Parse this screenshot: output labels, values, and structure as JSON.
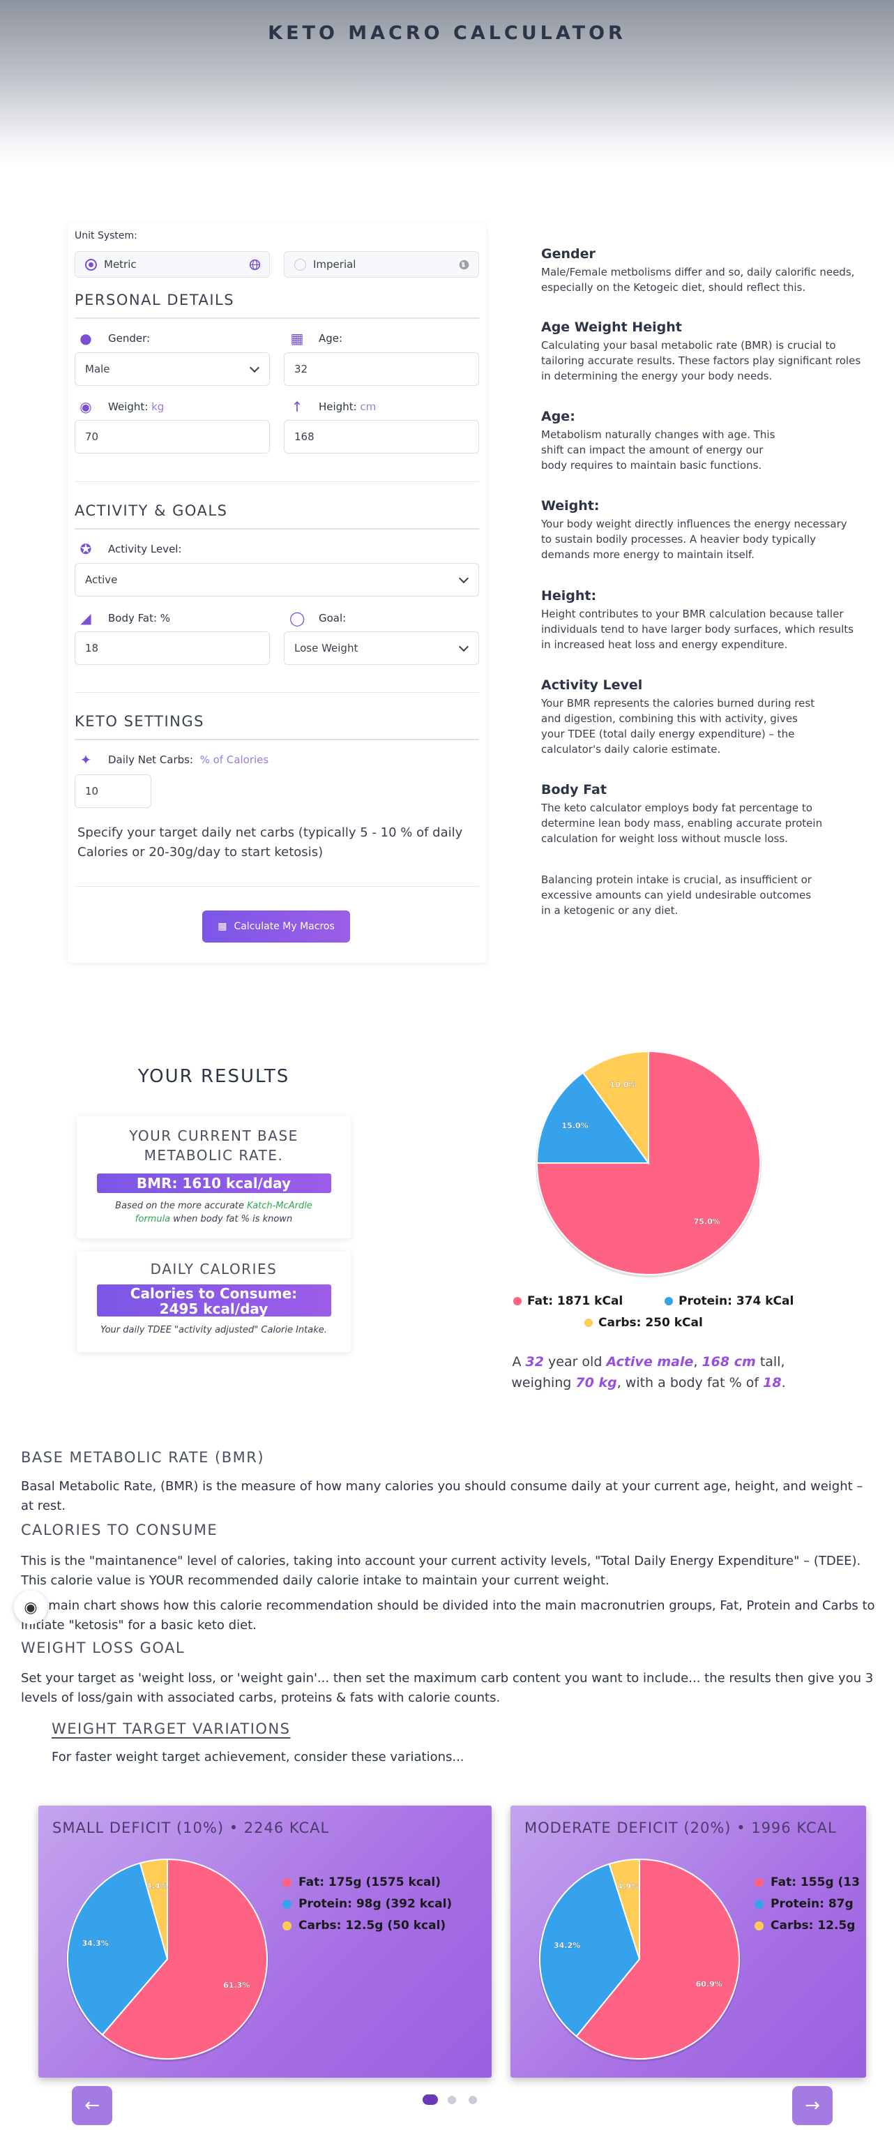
{
  "header": {
    "title": "KETO MACRO CALCULATOR"
  },
  "form": {
    "unit_system_label": "Unit System:",
    "unit_options": [
      "Metric",
      "Imperial"
    ],
    "personal_title": "PERSONAL DETAILS",
    "gender_label": "Gender:",
    "gender_value": "Male",
    "age_label": "Age:",
    "age_value": "32",
    "weight_label": "Weight:",
    "weight_unit": "kg",
    "weight_value": "70",
    "height_label": "Height:",
    "height_unit": "cm",
    "height_value": "168",
    "activity_title": "ACTIVITY & GOALS",
    "activity_label": "Activity Level:",
    "activity_value": "Active",
    "bodyfat_label": "Body Fat: %",
    "bodyfat_value": "18",
    "goal_label": "Goal:",
    "goal_value": "Lose Weight",
    "keto_title": "KETO SETTINGS",
    "carbs_label": "Daily Net Carbs:",
    "carbs_unit": "% of Calories",
    "carbs_value": "10",
    "carbs_help": "Specify your target daily net carbs (typically 5 - 10 % of daily Calories or 20-30g/day to start ketosis)",
    "calculate_label": "Calculate My Macros"
  },
  "info": [
    {
      "title": "Gender",
      "text": "Male/Female metbolisms differ and so, daily calorific needs, especially on the Ketogeic diet, should reflect this."
    },
    {
      "title": "Age Weight Height",
      "text": "Calculating your basal metabolic rate (BMR) is crucial to tailoring accurate results. These factors play significant roles in determining the energy your body needs."
    },
    {
      "title": "Age:",
      "text": "Metabolism naturally changes with age. This shift can impact the amount of energy our body requires to maintain basic functions."
    },
    {
      "title": "Weight:",
      "text": "Your body weight directly influences the energy necessary to sustain bodily processes. A heavier body typically demands more energy to maintain itself."
    },
    {
      "title": "Height:",
      "text": "Height contributes to your BMR calculation because taller individuals tend to have larger body surfaces, which results in increased heat loss and energy expenditure."
    },
    {
      "title": "Activity Level",
      "text": "Your BMR represents the calories burned during rest and digestion, combining this with activity, gives your TDEE (total daily energy expenditure) – the calculator's daily calorie estimate."
    },
    {
      "title": "Body Fat",
      "text": "The keto calculator employs body fat percentage to determine lean body mass, enabling accurate protein calculation for weight loss without muscle loss."
    },
    {
      "title": "",
      "text": "Balancing protein intake is crucial, as insufficient or excessive amounts can yield undesirable outcomes in a ketogenic or any diet."
    }
  ],
  "results": {
    "title": "YOUR RESULTS",
    "bmr_heading": "YOUR CURRENT BASE METABOLIC RATE.",
    "bmr_value": "BMR: 1610 kcal/day",
    "bmr_note_pre": "Based on the more accurate ",
    "bmr_note_link": "Katch-McArdle formula",
    "bmr_note_post": " when body fat % is known",
    "daily_heading": "DAILY CALORIES",
    "daily_value_1": "Calories to Consume:",
    "daily_value_2": "2495 kcal/day",
    "daily_note": "Your daily TDEE \"activity adjusted\" Calorie Intake.",
    "summary": {
      "p1": "A ",
      "age": "32",
      "p2": " year old ",
      "activity": "Active male",
      "p3": ", ",
      "height": "168 cm",
      "p4": " tall, weighing ",
      "weight": "70 kg",
      "p5": ", with a body fat % of ",
      "bodyfat": "18",
      "p6": "."
    }
  },
  "chart_data": [
    {
      "type": "pie",
      "categories": [
        "Fat",
        "Protein",
        "Carbs"
      ],
      "values": [
        75.0,
        15.0,
        10.0
      ],
      "slice_labels": [
        "75.0%",
        "15.0%",
        "10.0%"
      ],
      "legend": [
        "Fat: 1871 kCal",
        "Protein: 374 kCal",
        "Carbs: 250 kCal"
      ]
    },
    {
      "type": "pie",
      "title": "SMALL DEFICIT (10%) • 2246 KCAL",
      "categories": [
        "Fat",
        "Protein",
        "Carbs"
      ],
      "values": [
        61.3,
        34.3,
        4.4
      ],
      "slice_labels": [
        "61.3%",
        "34.3%",
        "4.4%"
      ],
      "legend": [
        "Fat: 175g (1575 kcal)",
        "Protein: 98g (392 kcal)",
        "Carbs: 12.5g (50 kcal)"
      ]
    },
    {
      "type": "pie",
      "title": "MODERATE DEFICIT (20%) • 1996 KCAL",
      "categories": [
        "Fat",
        "Protein",
        "Carbs"
      ],
      "values": [
        60.9,
        34.2,
        4.9
      ],
      "slice_labels": [
        "60.9%",
        "34.2%",
        "4.9%"
      ],
      "legend": [
        "Fat: 155g (13",
        "Protein: 87g",
        "Carbs: 12.5g"
      ]
    }
  ],
  "colors": {
    "fat": "#ff6384",
    "protein": "#36a2eb",
    "carbs": "#ffcd56",
    "accent": "#7b57e6"
  },
  "explain": {
    "bmr_title": "BASE METABOLIC RATE (BMR)",
    "bmr_text": "Basal Metabolic Rate, (BMR) is the measure of how many calories you should consume daily at your current age, height, and weight – at rest.",
    "cal_title": "CALORIES TO CONSUME",
    "cal_text_1": "This is the \"maintanence\" level of calories, taking into account your current activity levels, \"Total Daily Energy Expenditure\" – (TDEE). This calorie value is YOUR recommended daily calorie intake to maintain your current weight.",
    "cal_text_2": "The main chart shows how this calorie recommendation should be divided into the main macronutrien groups, Fat, Protein and Carbs to initiate \"ketosis\" for a basic keto diet.",
    "wl_title": "WEIGHT LOSS GOAL",
    "wl_text": "Set your target as 'weight loss, or 'weight gain'... then set the maximum carb content you want to include... the results then give you 3 levels of loss/gain with associated carbs, proteins & fats with calorie counts.",
    "variations_title": "WEIGHT TARGET VARIATIONS",
    "variations_text": "For faster weight target achievement, consider these variations..."
  },
  "carousel": {
    "prev": "←",
    "next": "→"
  }
}
